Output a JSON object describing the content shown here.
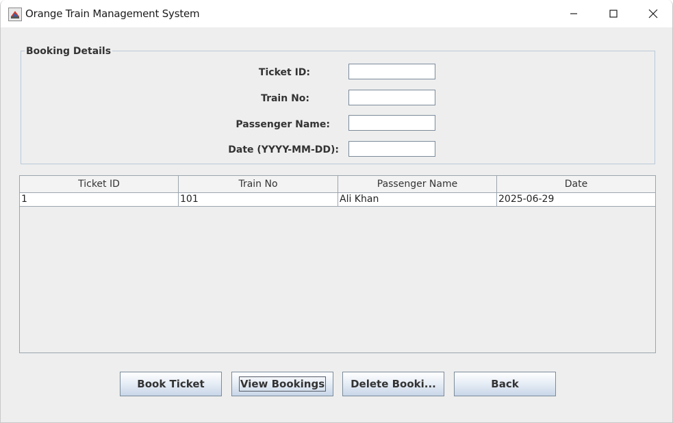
{
  "window": {
    "title": "Orange Train Management System",
    "icon": "java-coffee-cup-icon",
    "controls": [
      "minimize-icon",
      "maximize-icon",
      "close-icon"
    ]
  },
  "booking_details": {
    "title": "Booking Details",
    "fields": [
      {
        "label": "Ticket ID:",
        "value": ""
      },
      {
        "label": "Train No:",
        "value": ""
      },
      {
        "label": "Passenger Name:",
        "value": ""
      },
      {
        "label": "Date (YYYY-MM-DD):",
        "value": ""
      }
    ]
  },
  "table": {
    "columns": [
      "Ticket ID",
      "Train No",
      "Passenger Name",
      "Date"
    ],
    "rows": [
      [
        "1",
        "101",
        "Ali Khan",
        "2025-06-29"
      ]
    ]
  },
  "buttons": {
    "book": "Book Ticket",
    "view": "View Bookings",
    "delete": "Delete Booki...",
    "back": "Back"
  },
  "colors": {
    "window_bg": "#eeeeee",
    "titlebar_bg": "#ffffff",
    "border": "#9aa4ae",
    "group_border": "#b8c8d8",
    "button_gradient_bottom": "#c8d6e8"
  }
}
